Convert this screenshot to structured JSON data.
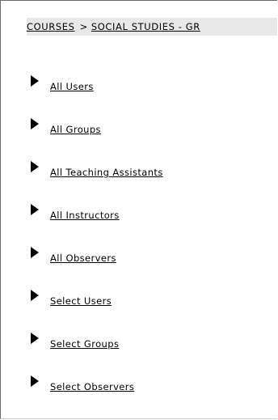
{
  "breadcrumb": {
    "items": [
      "COURSES",
      "SOCIAL STUDIES - GR"
    ],
    "separator": ">"
  },
  "nav": {
    "items": [
      {
        "label": "All Users"
      },
      {
        "label": "All Groups"
      },
      {
        "label": "All Teaching Assistants"
      },
      {
        "label": "All Instructors"
      },
      {
        "label": "All Observers"
      },
      {
        "label": "Select Users"
      },
      {
        "label": "Select Groups"
      },
      {
        "label": "Select Observers"
      }
    ]
  }
}
